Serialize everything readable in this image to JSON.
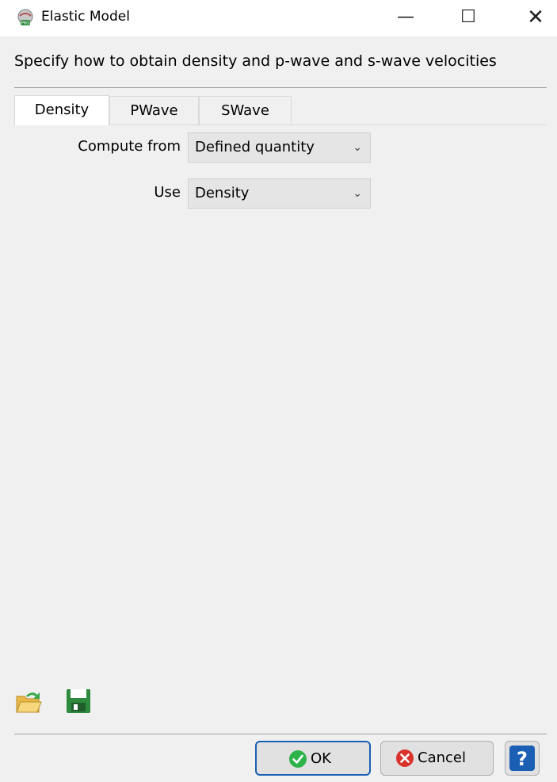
{
  "window": {
    "title": "Elastic Model",
    "minimize_glyph": "—",
    "maximize_glyph": "☐",
    "close_glyph": "✕"
  },
  "instruction": "Specify how to obtain density and p-wave and s-wave velocities",
  "tabs": [
    {
      "label": "Density",
      "active": true
    },
    {
      "label": "PWave",
      "active": false
    },
    {
      "label": "SWave",
      "active": false
    }
  ],
  "form": {
    "compute_from": {
      "label": "Compute from",
      "value": "Defined quantity"
    },
    "use": {
      "label": "Use",
      "value": "Density"
    }
  },
  "toolbar": {
    "open_icon": "open-folder-icon",
    "save_icon": "save-disk-icon"
  },
  "buttons": {
    "ok_label": "OK",
    "cancel_label": "Cancel",
    "help_glyph": "?"
  },
  "colors": {
    "ok_green": "#2eb34a",
    "cancel_red": "#d9342b",
    "help_blue": "#1a5fb4"
  }
}
